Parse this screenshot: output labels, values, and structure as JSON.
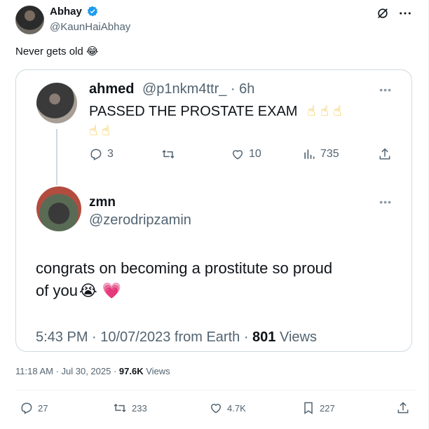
{
  "tweet": {
    "author_name": "Abhay",
    "author_handle": "@KaunHaiAbhay",
    "text": "Never gets old",
    "text_emoji": "😂",
    "timestamp": "11:18 AM · Jul 30, 2025 · ",
    "views_count": "97.6K",
    "views_label": " Views",
    "stats": {
      "replies": "27",
      "retweets": "233",
      "likes": "4.7K",
      "bookmarks": "227"
    }
  },
  "quoted": {
    "first": {
      "name": "ahmed",
      "handle_time": "@p1nkm4ttr_ · 6h",
      "text": "PASSED THE PROSTATE EXAM",
      "emojis_line1": "☝ ☝ ☝",
      "emojis_line2": "☝ ☝",
      "stats": {
        "replies": "3",
        "likes": "10",
        "views": "735"
      }
    },
    "second": {
      "name": "zmn",
      "handle": "@zerodripzamin",
      "text_line1": "congrats on becoming a prostitute so proud",
      "text_line2": "of you",
      "emojis": "😭 💗",
      "meta_time": "5:43 PM · 10/07/2023 from Earth · ",
      "meta_views_count": "801",
      "meta_views_label": " Views"
    }
  },
  "colors": {
    "verified": "#1d9bf0",
    "secondary_text": "#536471",
    "border": "#cfd9de"
  }
}
